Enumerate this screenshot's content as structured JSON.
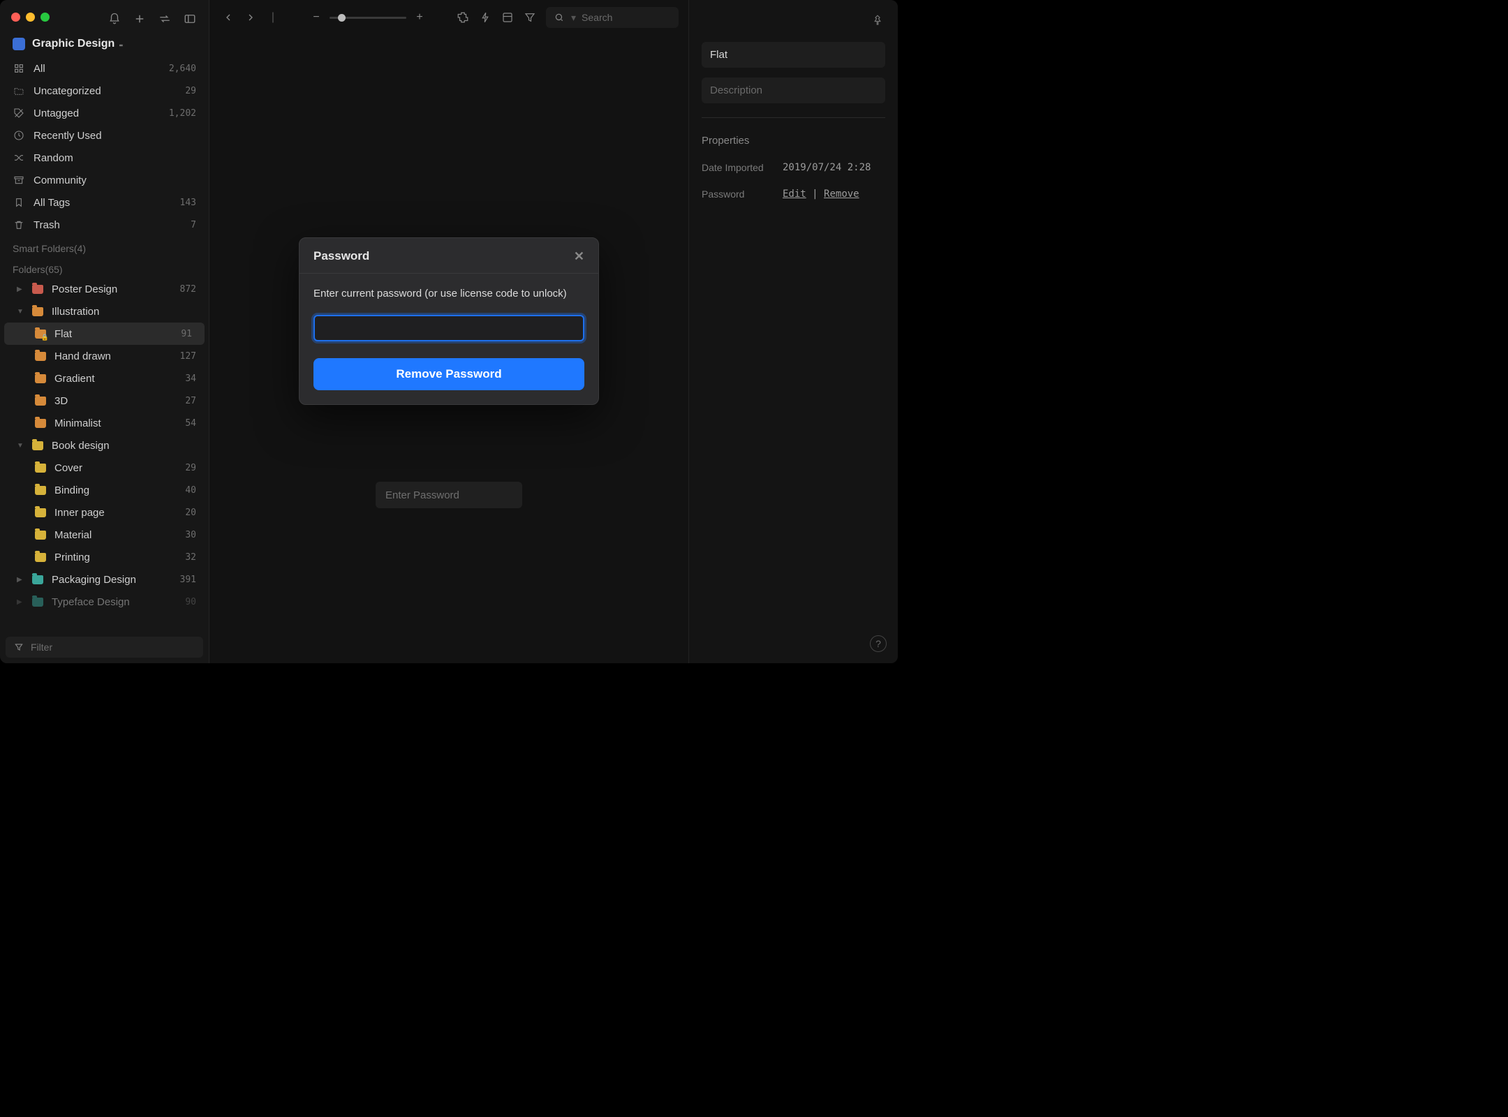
{
  "library": {
    "name": "Graphic Design"
  },
  "sidebar": {
    "filter_placeholder": "Filter",
    "collections": [
      {
        "label": "All",
        "count": "2,640"
      },
      {
        "label": "Uncategorized",
        "count": "29"
      },
      {
        "label": "Untagged",
        "count": "1,202"
      },
      {
        "label": "Recently Used",
        "count": ""
      },
      {
        "label": "Random",
        "count": ""
      },
      {
        "label": "Community",
        "count": ""
      },
      {
        "label": "All Tags",
        "count": "143"
      },
      {
        "label": "Trash",
        "count": "7"
      }
    ],
    "smart_label": "Smart Folders(4)",
    "folders_label": "Folders(65)",
    "folders": {
      "poster": {
        "label": "Poster Design",
        "count": "872"
      },
      "illustration": {
        "label": "Illustration",
        "count": ""
      },
      "illus_children": [
        {
          "label": "Flat",
          "count": "91",
          "selected": true,
          "locked": true
        },
        {
          "label": "Hand drawn",
          "count": "127"
        },
        {
          "label": "Gradient",
          "count": "34"
        },
        {
          "label": "3D",
          "count": "27"
        },
        {
          "label": "Minimalist",
          "count": "54"
        }
      ],
      "book": {
        "label": "Book design",
        "count": ""
      },
      "book_children": [
        {
          "label": "Cover",
          "count": "29"
        },
        {
          "label": "Binding",
          "count": "40"
        },
        {
          "label": "Inner page",
          "count": "20"
        },
        {
          "label": "Material",
          "count": "30"
        },
        {
          "label": "Printing",
          "count": "32"
        }
      ],
      "packaging": {
        "label": "Packaging Design",
        "count": "391"
      },
      "typeface": {
        "label": "Typeface Design",
        "count": "90"
      }
    }
  },
  "toolbar": {
    "search_placeholder": "Search"
  },
  "canvas": {
    "bg_pwd_placeholder": "Enter Password"
  },
  "inspector": {
    "title": "Flat",
    "description_placeholder": "Description",
    "properties_label": "Properties",
    "date_label": "Date Imported",
    "date_value": "2019/07/24 2:28",
    "password_label": "Password",
    "edit_label": "Edit",
    "sep": "|",
    "remove_label": "Remove"
  },
  "modal": {
    "title": "Password",
    "body": "Enter current password (or use license code to unlock)",
    "button": "Remove Password"
  }
}
